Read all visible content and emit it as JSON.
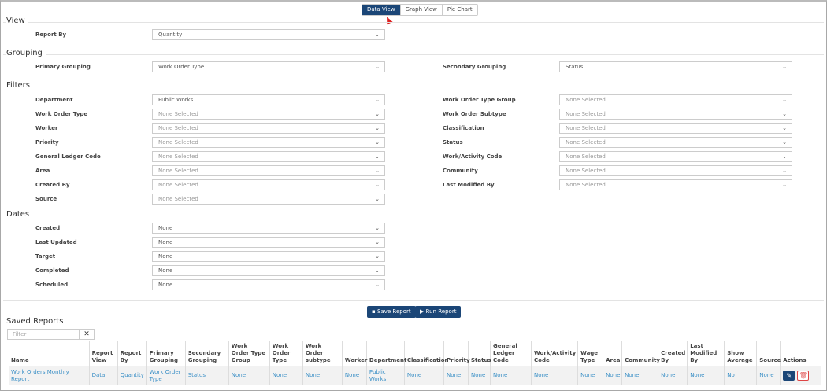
{
  "tabs": [
    "Data View",
    "Graph View",
    "Pie Chart"
  ],
  "sections": {
    "view": "View",
    "grouping": "Grouping",
    "filters": "Filters",
    "dates": "Dates",
    "saved": "Saved Reports"
  },
  "view": {
    "report_by_label": "Report By",
    "report_by_value": "Quantity"
  },
  "grouping": {
    "primary_label": "Primary Grouping",
    "primary_value": "Work Order Type",
    "secondary_label": "Secondary Grouping",
    "secondary_value": "Status"
  },
  "filters": {
    "left": [
      {
        "label": "Department",
        "value": "Public Works",
        "placeholder": false
      },
      {
        "label": "Work Order Type",
        "value": "None Selected",
        "placeholder": true
      },
      {
        "label": "Worker",
        "value": "None Selected",
        "placeholder": true
      },
      {
        "label": "Priority",
        "value": "None Selected",
        "placeholder": true
      },
      {
        "label": "General Ledger Code",
        "value": "None Selected",
        "placeholder": true
      },
      {
        "label": "Area",
        "value": "None Selected",
        "placeholder": true
      },
      {
        "label": "Created By",
        "value": "None Selected",
        "placeholder": true
      },
      {
        "label": "Source",
        "value": "None Selected",
        "placeholder": true
      }
    ],
    "right": [
      {
        "label": "Work Order Type Group",
        "value": "None Selected",
        "placeholder": true
      },
      {
        "label": "Work Order Subtype",
        "value": "None Selected",
        "placeholder": true
      },
      {
        "label": "Classification",
        "value": "None Selected",
        "placeholder": true
      },
      {
        "label": "Status",
        "value": "None Selected",
        "placeholder": true
      },
      {
        "label": "Work/Activity Code",
        "value": "None Selected",
        "placeholder": true
      },
      {
        "label": "Community",
        "value": "None Selected",
        "placeholder": true
      },
      {
        "label": "Last Modified By",
        "value": "None Selected",
        "placeholder": true
      }
    ]
  },
  "dates": [
    {
      "label": "Created",
      "value": "None"
    },
    {
      "label": "Last Updated",
      "value": "None"
    },
    {
      "label": "Target",
      "value": "None"
    },
    {
      "label": "Completed",
      "value": "None"
    },
    {
      "label": "Scheduled",
      "value": "None"
    }
  ],
  "buttons": {
    "save": "Save Report",
    "run": "Run Report"
  },
  "saved": {
    "filter_placeholder": "Filter",
    "columns": [
      "Name",
      "Report View",
      "Report By",
      "Primary Grouping",
      "Secondary Grouping",
      "Work Order Type Group",
      "Work Order Type",
      "Work Order subtype",
      "Worker",
      "Department",
      "Classification",
      "Priority",
      "Status",
      "General Ledger Code",
      "Work/Activity Code",
      "Wage Type",
      "Area",
      "Community",
      "Created By",
      "Last Modified By",
      "Show Average",
      "Source",
      "Actions"
    ],
    "rows": [
      [
        "Work Orders Monthly Report",
        "Data",
        "Quantity",
        "Work Order Type",
        "Status",
        "None",
        "None",
        "None",
        "None",
        "Public Works",
        "None",
        "None",
        "None",
        "None",
        "None",
        "None",
        "None",
        "None",
        "None",
        "None",
        "No",
        "None"
      ]
    ]
  }
}
